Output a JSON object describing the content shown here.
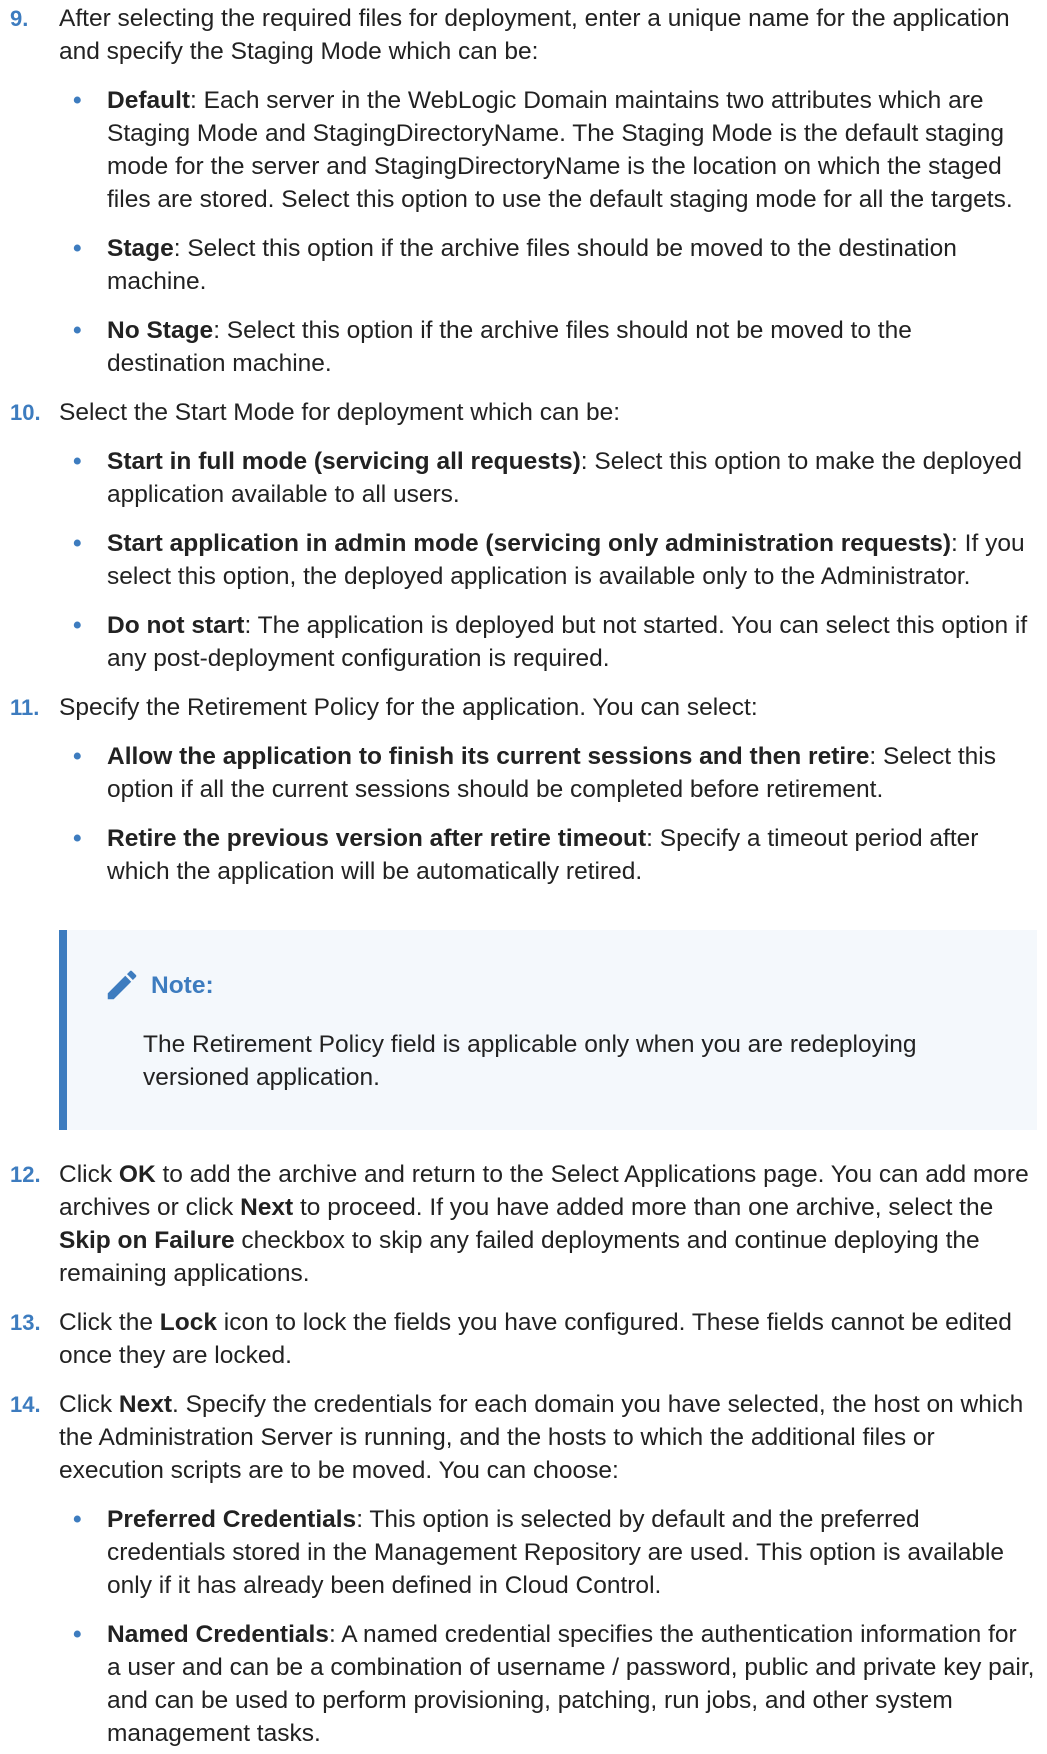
{
  "steps": [
    {
      "num": "9.",
      "text": "After selecting the required files for deployment, enter a unique name for the application and specify the Staging Mode which can be:",
      "bullets": [
        {
          "term": "Default",
          "text": ": Each server in the WebLogic Domain maintains two attributes which are Staging Mode and StagingDirectoryName. The Staging Mode is the default staging mode for the server and StagingDirectoryName is the location on which the staged files are stored. Select this option to use the default staging mode for all the targets."
        },
        {
          "term": "Stage",
          "text": ": Select this option if the archive files should be moved to the destination machine."
        },
        {
          "term": "No Stage",
          "text": ": Select this option if the archive files should not be moved to the destination machine."
        }
      ]
    },
    {
      "num": "10.",
      "text": "Select the Start Mode for deployment which can be:",
      "bullets": [
        {
          "term": "Start in full mode (servicing all requests)",
          "text": ": Select this option to make the deployed application available to all users."
        },
        {
          "term": "Start application in admin mode (servicing only administration requests)",
          "text": ": If you select this option, the deployed application is available only to the Administrator."
        },
        {
          "term": "Do not start",
          "text": ": The application is deployed but not started. You can select this option if any post-deployment configuration is required."
        }
      ]
    },
    {
      "num": "11.",
      "text": "Specify the Retirement Policy for the application. You can select:",
      "bullets": [
        {
          "term": "Allow the application to finish its current sessions and then retire",
          "text": ": Select this option if all the current sessions should be completed before retirement."
        },
        {
          "term": "Retire the previous version after retire timeout",
          "text": ": Specify a timeout period after which the application will be automatically retired."
        }
      ]
    }
  ],
  "note": {
    "title": "Note:",
    "text": "The Retirement Policy field is applicable only when you are redeploying versioned application.",
    "icon": "pencil-icon"
  },
  "step12": {
    "num": "12.",
    "t1": "Click ",
    "b1": "OK",
    "t2": " to add the archive and return to the Select Applications page. You can add more archives or click ",
    "b2": "Next",
    "t3": " to proceed. If you have added more than one archive, select the ",
    "b3": "Skip on Failure",
    "t4": " checkbox to skip any failed deployments and continue deploying the remaining applications."
  },
  "step13": {
    "num": "13.",
    "t1": "Click the ",
    "b1": "Lock",
    "t2": " icon to lock the fields you have configured. These fields cannot be edited once they are locked."
  },
  "step14": {
    "num": "14.",
    "t1": "Click ",
    "b1": "Next",
    "t2": ". Specify the credentials for each domain you have selected, the host on which the Administration Server is running, and the hosts to which the additional files or execution scripts are to be moved. You can choose:",
    "bullets": [
      {
        "term": "Preferred Credentials",
        "text": ": This option is selected by default and the preferred credentials stored in the Management Repository are used. This option is available only if it has already been defined in Cloud Control."
      },
      {
        "term": "Named Credentials",
        "text": ": A named credential specifies the authentication information for a user and can be a combination of username / password, public and private key pair, and can be used to perform provisioning, patching, run jobs, and other system management tasks."
      }
    ]
  },
  "bullet_glyph": "•",
  "accent_color": "#3d7cbf"
}
